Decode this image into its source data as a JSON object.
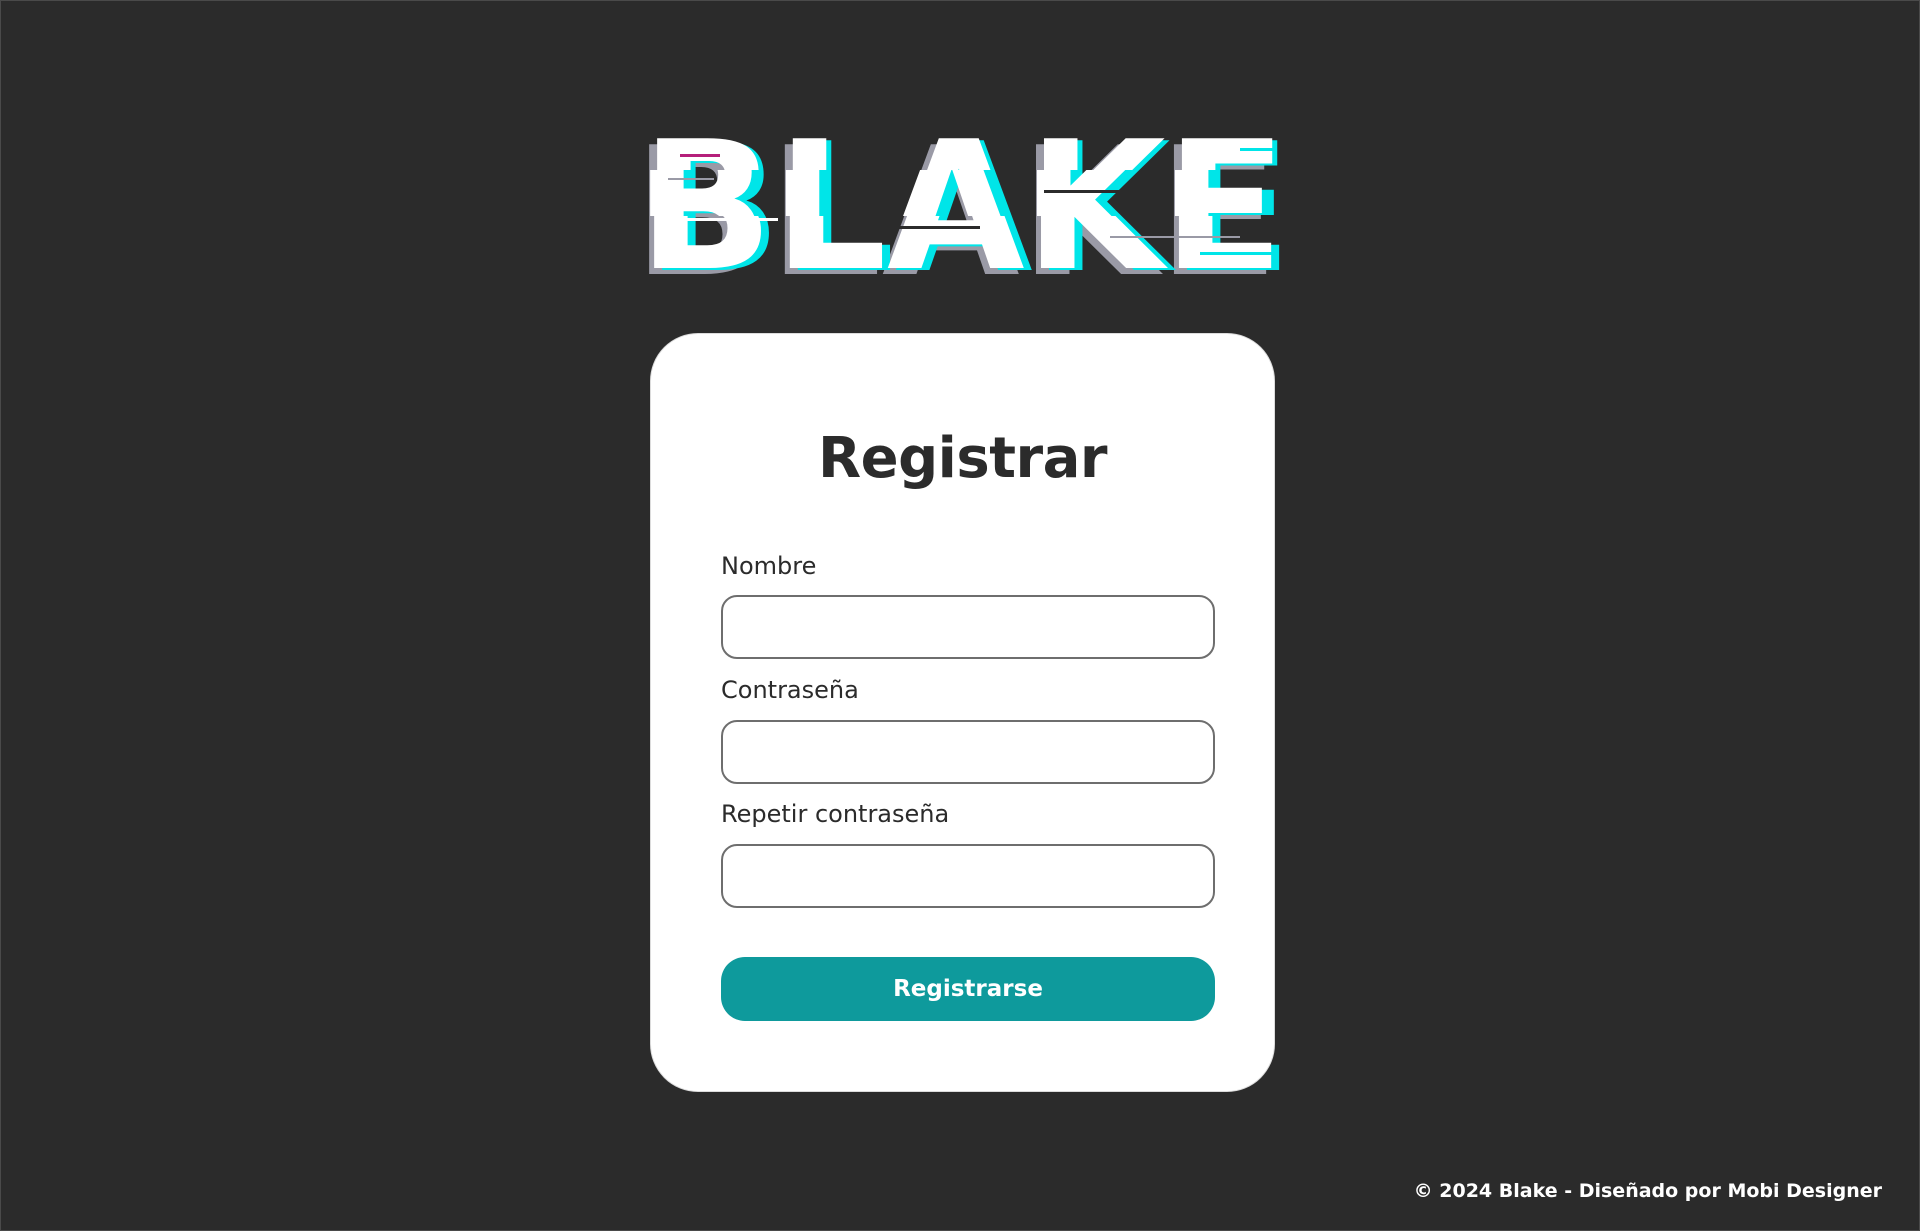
{
  "logo": {
    "text": "BLAKE",
    "colors": {
      "main": "#ffffff",
      "cyan": "#00e5e8",
      "shadow": "#9a9aa6",
      "magenta": "#b51f7a"
    }
  },
  "form": {
    "title": "Registrar",
    "fields": [
      {
        "label": "Nombre",
        "value": "",
        "placeholder": ""
      },
      {
        "label": "Contraseña",
        "value": "",
        "placeholder": ""
      },
      {
        "label": "Repetir contraseña",
        "value": "",
        "placeholder": ""
      }
    ],
    "submit_label": "Registrarse",
    "accent_color": "#0e9a9c"
  },
  "footer": {
    "text": "© 2024 Blake - Diseñado por Mobi Designer"
  },
  "theme": {
    "background": "#2b2b2b",
    "card_background": "#ffffff",
    "text_dark": "#2b2b2b"
  }
}
